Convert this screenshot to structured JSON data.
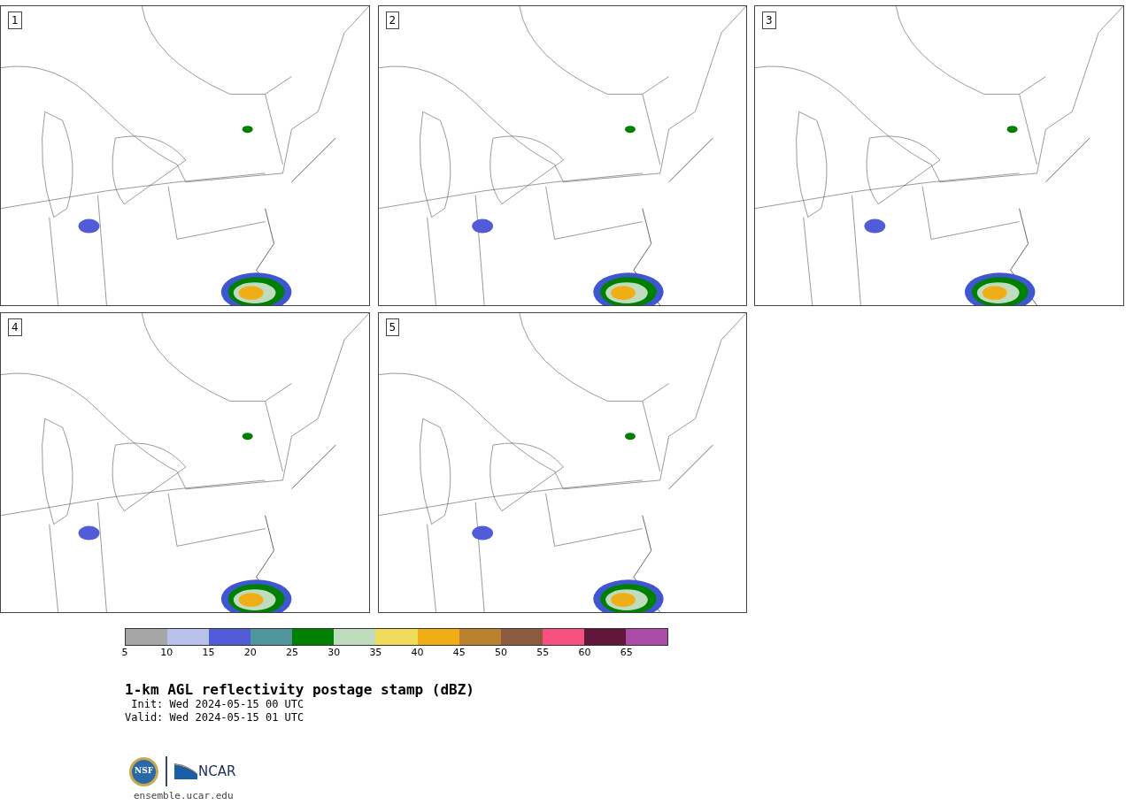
{
  "panels": [
    {
      "label": "1"
    },
    {
      "label": "2"
    },
    {
      "label": "3"
    },
    {
      "label": "4"
    },
    {
      "label": "5"
    }
  ],
  "colorbar": [
    {
      "tick": "5",
      "color": "#a6a6a6"
    },
    {
      "tick": "10",
      "color": "#b7c1ec"
    },
    {
      "tick": "15",
      "color": "#525cd8"
    },
    {
      "tick": "20",
      "color": "#4e959c"
    },
    {
      "tick": "25",
      "color": "#008000"
    },
    {
      "tick": "30",
      "color": "#bfddbe"
    },
    {
      "tick": "35",
      "color": "#eedb59"
    },
    {
      "tick": "40",
      "color": "#efae16"
    },
    {
      "tick": "45",
      "color": "#ba822e"
    },
    {
      "tick": "50",
      "color": "#8b5a3f"
    },
    {
      "tick": "55",
      "color": "#f5507f"
    },
    {
      "tick": "60",
      "color": "#611838"
    },
    {
      "tick": "65",
      "color": "#ac4aa8"
    }
  ],
  "title": "1-km AGL reflectivity postage stamp (dBZ)",
  "init": " Init: Wed 2024-05-15 00 UTC",
  "valid": "Valid: Wed 2024-05-15 01 UTC",
  "logo": {
    "nsf": "NSF",
    "ncar": "NCAR"
  },
  "url": "ensemble.ucar.edu"
}
